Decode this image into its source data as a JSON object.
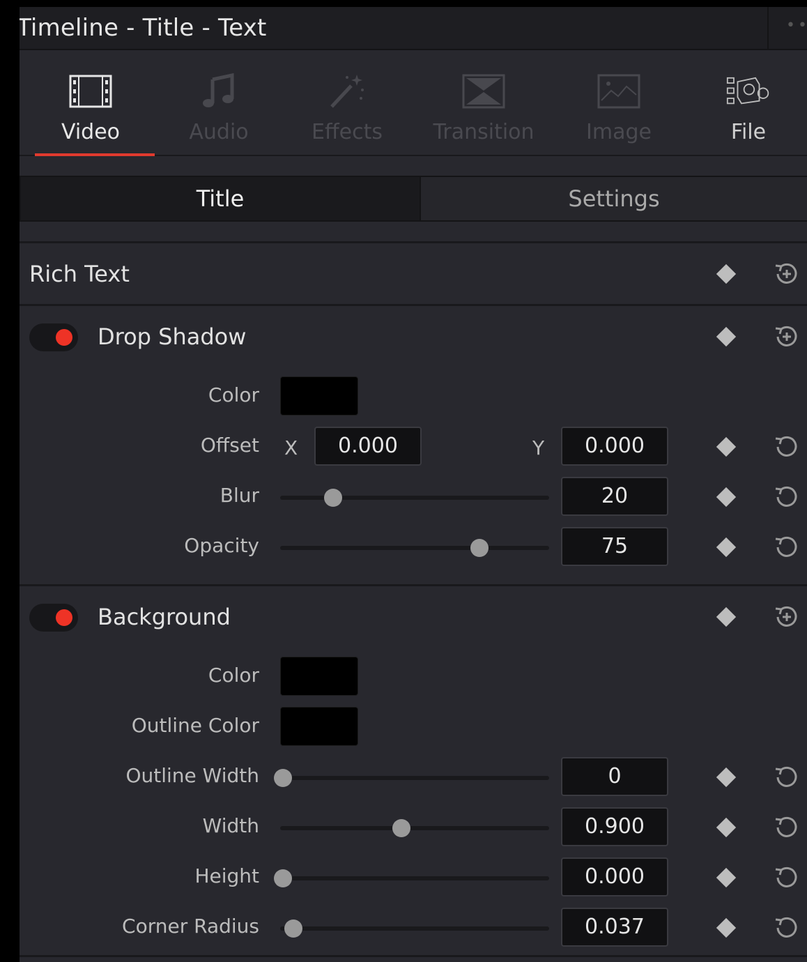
{
  "window": {
    "title": "Timeline - Title - Text"
  },
  "tabs": [
    {
      "label": "Video",
      "icon": "film-icon",
      "active": true
    },
    {
      "label": "Audio",
      "icon": "music-note-icon",
      "active": false
    },
    {
      "label": "Effects",
      "icon": "magic-wand-icon",
      "active": false
    },
    {
      "label": "Transition",
      "icon": "transition-icon",
      "active": false
    },
    {
      "label": "Image",
      "icon": "image-icon",
      "active": false
    },
    {
      "label": "File",
      "icon": "file-camera-icon",
      "active": false
    }
  ],
  "subtabs": {
    "title": "Title",
    "settings": "Settings"
  },
  "rich_text": {
    "label": "Rich Text"
  },
  "drop_shadow": {
    "label": "Drop Shadow",
    "enabled": true,
    "color_label": "Color",
    "color": "#000000",
    "offset_label": "Offset",
    "offset_x_label": "X",
    "offset_x": "0.000",
    "offset_y_label": "Y",
    "offset_y": "0.000",
    "blur_label": "Blur",
    "blur": "20",
    "opacity_label": "Opacity",
    "opacity": "75"
  },
  "background": {
    "label": "Background",
    "enabled": true,
    "color_label": "Color",
    "color": "#000000",
    "outline_color_label": "Outline Color",
    "outline_color": "#000000",
    "outline_width_label": "Outline Width",
    "outline_width": "0",
    "width_label": "Width",
    "width": "0.900",
    "height_label": "Height",
    "height": "0.000",
    "corner_radius_label": "Corner Radius",
    "corner_radius": "0.037"
  },
  "colors": {
    "accent": "#e03a2e",
    "toggle_on": "#ee3326",
    "panel_bg": "#28282e"
  }
}
